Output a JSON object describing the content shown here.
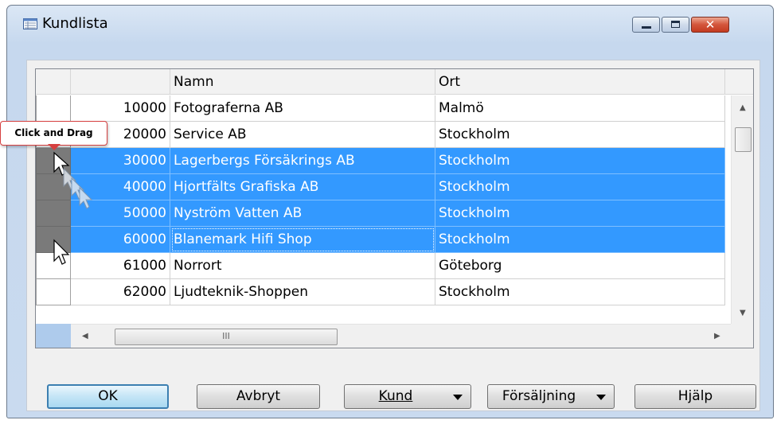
{
  "window": {
    "title": "Kundlista",
    "close_glyph": "✕"
  },
  "grid": {
    "columns": [
      "",
      "Namn",
      "Ort"
    ],
    "rows": [
      {
        "number": "10000",
        "name": "Fotograferna AB",
        "ort": "Malmö",
        "selected": false
      },
      {
        "number": "20000",
        "name": "Service AB",
        "ort": "Stockholm",
        "selected": false
      },
      {
        "number": "30000",
        "name": "Lagerbergs Försäkrings AB",
        "ort": "Stockholm",
        "selected": true
      },
      {
        "number": "40000",
        "name": "Hjortfälts Grafiska AB",
        "ort": "Stockholm",
        "selected": true
      },
      {
        "number": "50000",
        "name": "Nyström Vatten AB",
        "ort": "Stockholm",
        "selected": true
      },
      {
        "number": "60000",
        "name": "Blanemark Hifi Shop",
        "ort": "Stockholm",
        "selected": true
      },
      {
        "number": "61000",
        "name": "Norrort",
        "ort": "Göteborg",
        "selected": false
      },
      {
        "number": "62000",
        "name": "Ljudteknik-Shoppen",
        "ort": "Stockholm",
        "selected": false
      }
    ],
    "hscroll_grip": "III",
    "scroll_up": "▲",
    "scroll_down": "▼",
    "scroll_left": "◀",
    "scroll_right": "▶"
  },
  "callout": {
    "text": "Click and Drag"
  },
  "buttons": {
    "ok": "OK",
    "avbryt": "Avbryt",
    "kund": "Kund",
    "forsaljning": "Försäljning",
    "hjalp": "Hjälp"
  },
  "colors": {
    "selection": "#3399ff",
    "window_frame": "#c6d8ee",
    "callout_border": "#d64040"
  }
}
